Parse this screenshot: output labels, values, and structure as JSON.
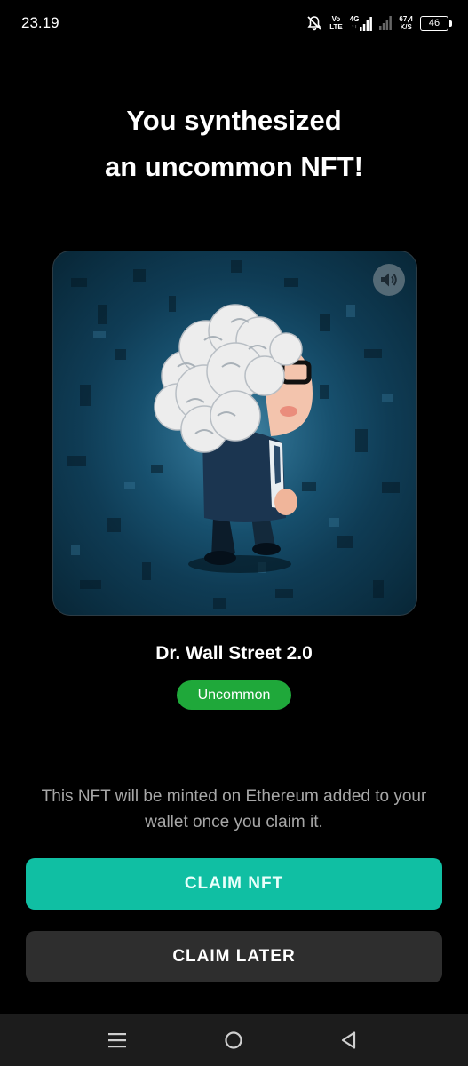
{
  "status_bar": {
    "time": "23.19",
    "network_top": "Vo",
    "network_bottom": "LTE",
    "signal_label": "4G",
    "speed_value": "67,4",
    "speed_unit": "K/S",
    "battery": "46"
  },
  "title": {
    "line1": "You synthesized",
    "line2": "an uncommon NFT!"
  },
  "nft": {
    "name": "Dr. Wall Street 2.0",
    "rarity": "Uncommon",
    "rarity_color": "#1fa83a"
  },
  "info_text": "This NFT will be minted on Ethereum added to your wallet once you claim it.",
  "buttons": {
    "claim_nft": "CLAIM NFT",
    "claim_later": "CLAIM LATER"
  },
  "colors": {
    "accent": "#10bfa3",
    "background": "#000000",
    "secondary_button": "#2e2e2e"
  },
  "icons": {
    "sound": "speaker-icon",
    "nav_recents": "menu-lines-icon",
    "nav_home": "home-circle-icon",
    "nav_back": "back-triangle-icon"
  }
}
